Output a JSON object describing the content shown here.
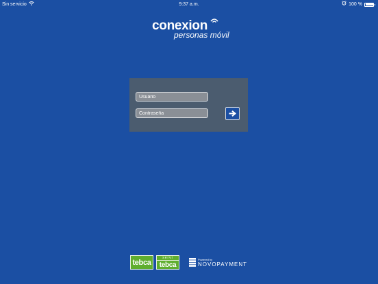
{
  "status_bar": {
    "carrier": "Sin servicio",
    "time": "9:37 a.m.",
    "battery": "100 %",
    "battery_level": 1.0,
    "icons": [
      "wifi-icon",
      "alarm-icon",
      "battery-icon"
    ]
  },
  "logo": {
    "brand": "conexion",
    "subtitle": "personas móvil"
  },
  "login": {
    "username_placeholder": "Usuario",
    "password_placeholder": "Contraseña",
    "submit_icon": "arrow-right-icon"
  },
  "footer": {
    "tebca": "tebca",
    "servitebca_small": "servi",
    "servitebca_big": "tebca",
    "powered_by": "Powered by",
    "novopayment": "NOVOPAYMENT"
  },
  "colors": {
    "background": "#1b4fa3",
    "panel": "#4b5c6f",
    "green": "#5fae2e"
  }
}
